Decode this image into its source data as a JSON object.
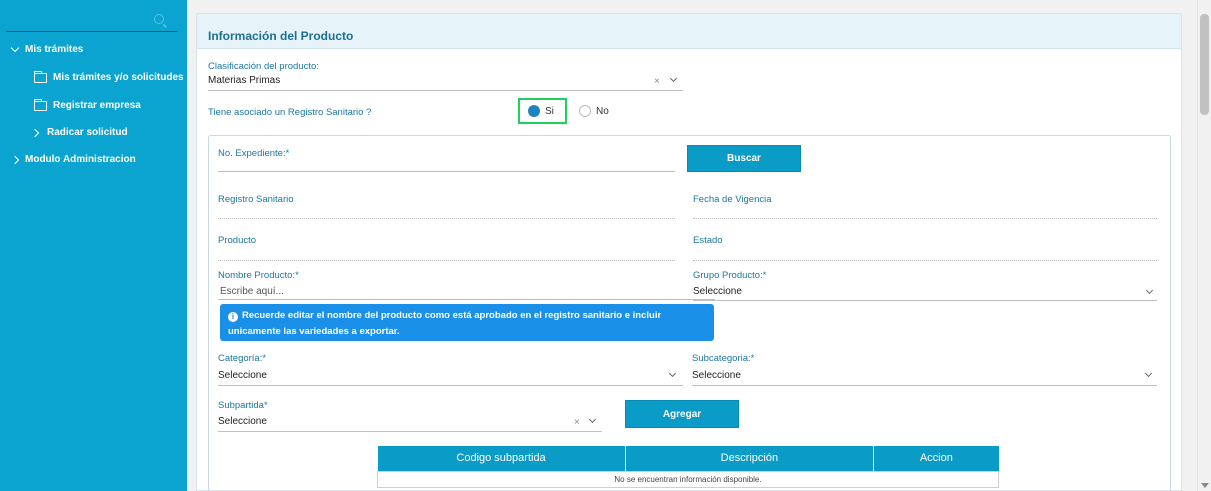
{
  "sidebar": {
    "items": [
      {
        "label": "Mis trámites",
        "icon": "chevron-down-icon"
      },
      {
        "label": "Mis trámites y/o solicitudes",
        "icon": "folder-icon"
      },
      {
        "label": "Registrar empresa",
        "icon": "folder-icon"
      },
      {
        "label": "Radicar solicitud",
        "icon": "chevron-right-icon"
      },
      {
        "label": "Modulo Administracion",
        "icon": "chevron-right-icon"
      }
    ]
  },
  "panel": {
    "title": "Información del Producto",
    "clasificacion": {
      "label": "Clasificación del producto:",
      "value": "Materias Primas",
      "clear": "×"
    },
    "registro_question": {
      "label": "Tiene asociado un Registro Sanitario ?",
      "option_yes": "Si",
      "option_no": "No",
      "selected": "Si"
    }
  },
  "form": {
    "expediente_label": "No. Expediente:*",
    "buscar_button": "Buscar",
    "registro_sanitario_label": "Registro Sanitario",
    "fecha_vigencia_label": "Fecha de Vigencia",
    "producto_label": "Producto",
    "estado_label": "Estado",
    "nombre_producto": {
      "label": "Nombre Producto:*",
      "placeholder": "Escribe aquí..."
    },
    "grupo_producto": {
      "label": "Grupo Producto:*",
      "value": "Seleccione"
    },
    "info_message": "Recuerde editar el nombre del producto como está aprobado en el registro sanitario e incluir unicamente las variedades a exportar.",
    "categoria": {
      "label": "Categoría:*",
      "value": "Seleccione"
    },
    "subcategoria": {
      "label": "Subcategoria:*",
      "value": "Seleccione"
    },
    "subpartida": {
      "label": "Subpartida*",
      "value": "Seleccione",
      "clear": "×"
    },
    "agregar_button": "Agregar"
  },
  "table": {
    "headers": [
      "Codigo subpartida",
      "Descripción",
      "Accion"
    ],
    "empty_message": "No se encuentran información disponible."
  },
  "colors": {
    "sidebar": "#0ba3cf",
    "accent": "#0a9cc7",
    "label": "#1b77a0",
    "highlight": "#21d160",
    "info": "#1a90e8"
  }
}
